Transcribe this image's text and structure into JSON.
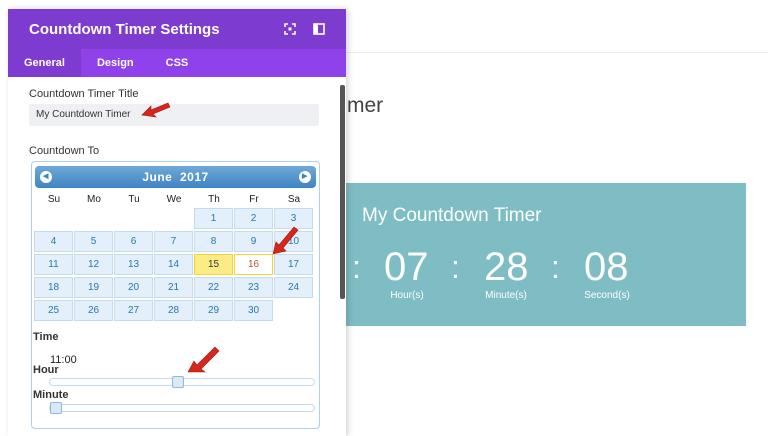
{
  "panel": {
    "title": "Countdown Timer Settings",
    "tabs": [
      "General",
      "Design",
      "CSS"
    ],
    "icons": [
      "expand-icon",
      "sidebar-icon"
    ]
  },
  "fields": {
    "title_label": "Countdown Timer Title",
    "title_value": "My Countdown Timer",
    "countdown_to_label": "Countdown To"
  },
  "calendar": {
    "month_year": "June  2017",
    "weekdays": [
      "Su",
      "Mo",
      "Tu",
      "We",
      "Th",
      "Fr",
      "Sa"
    ],
    "weeks": [
      [
        "",
        "",
        "",
        "",
        "1",
        "2",
        "3"
      ],
      [
        "4",
        "5",
        "6",
        "7",
        "8",
        "9",
        "10"
      ],
      [
        "11",
        "12",
        "13",
        "14",
        "15",
        "16",
        "17"
      ],
      [
        "18",
        "19",
        "20",
        "21",
        "22",
        "23",
        "24"
      ],
      [
        "25",
        "26",
        "27",
        "28",
        "29",
        "30",
        ""
      ]
    ],
    "today": "15",
    "selected": "16",
    "colors": {
      "header": "#3e84c4",
      "day_bg": "#e3effa",
      "today_bg": "#fbec88",
      "selected_text": "#c1572b"
    }
  },
  "time": {
    "label": "Time",
    "value": "11:00",
    "hour_label": "Hour",
    "hour_fraction": 0.48,
    "minute_label": "Minute",
    "minute_fraction": 0.0
  },
  "preview": {
    "page_title_fragment": "mer",
    "title": "My Countdown Timer",
    "hours": "07",
    "minutes": "28",
    "seconds": "08",
    "hours_label": "Hour(s)",
    "minutes_label": "Minute(s)",
    "seconds_label": "Second(s)",
    "separator": ":",
    "background": "#7fbdc4"
  },
  "colors": {
    "header": "#7e3bd0",
    "tabs": "#8f42ea",
    "arrow": "#d8261b"
  }
}
